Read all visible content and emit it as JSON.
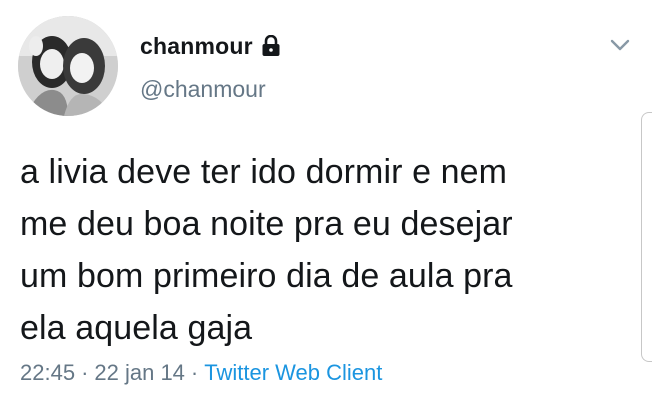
{
  "user": {
    "display_name": "chanmour",
    "handle": "@chanmour",
    "avatar_icon": "profile-photo",
    "protected_icon": "lock-icon"
  },
  "menu": {
    "icon": "chevron-down-icon"
  },
  "tweet": {
    "text": "a livia deve ter ido dormir e nem\nme deu boa noite pra eu desejar\num bom primeiro dia de aula pra\nela aquela gaja"
  },
  "meta": {
    "time": "22:45",
    "separator": "·",
    "date": "22 jan 14",
    "source": "Twitter Web Client"
  },
  "colors": {
    "text": "#14171a",
    "secondary": "#657786",
    "link": "#1b95e0"
  }
}
